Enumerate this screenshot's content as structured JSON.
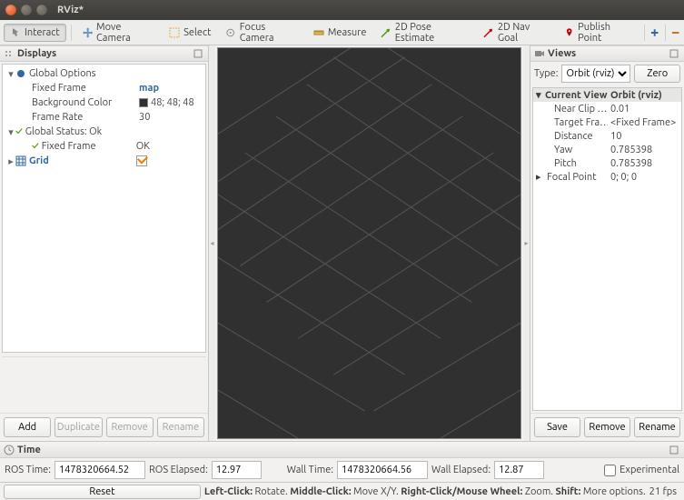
{
  "window": {
    "title": "RViz*"
  },
  "toolbar": [
    {
      "label": "Interact",
      "icon": "interact-icon",
      "active": true
    },
    {
      "label": "Move Camera",
      "icon": "move-camera-icon"
    },
    {
      "label": "Select",
      "icon": "select-icon"
    },
    {
      "label": "Focus Camera",
      "icon": "focus-camera-icon"
    },
    {
      "label": "Measure",
      "icon": "measure-icon"
    },
    {
      "label": "2D Pose Estimate",
      "icon": "pose-estimate-icon"
    },
    {
      "label": "2D Nav Goal",
      "icon": "nav-goal-icon"
    },
    {
      "label": "Publish Point",
      "icon": "publish-point-icon"
    }
  ],
  "displays": {
    "title": "Displays",
    "global_options": {
      "label": "Global Options",
      "fixed_frame": {
        "label": "Fixed Frame",
        "value": "map"
      },
      "background_color": {
        "label": "Background Color",
        "value": "48; 48; 48"
      },
      "frame_rate": {
        "label": "Frame Rate",
        "value": "30"
      }
    },
    "global_status": {
      "label": "Global Status: Ok",
      "fixed_frame": {
        "label": "Fixed Frame",
        "value": "OK"
      }
    },
    "grid": {
      "label": "Grid",
      "checked": true
    },
    "buttons": {
      "add": "Add",
      "duplicate": "Duplicate",
      "remove": "Remove",
      "rename": "Rename"
    }
  },
  "views": {
    "title": "Views",
    "type_label": "Type:",
    "type_value": "Orbit (rviz)",
    "zero": "Zero",
    "current_view": {
      "label": "Current View",
      "value": "Orbit (rviz)"
    },
    "props": [
      {
        "label": "Near Clip …",
        "value": "0.01"
      },
      {
        "label": "Target Fra…",
        "value": "<Fixed Frame>"
      },
      {
        "label": "Distance",
        "value": "10"
      },
      {
        "label": "Yaw",
        "value": "0.785398"
      },
      {
        "label": "Pitch",
        "value": "0.785398"
      },
      {
        "label": "Focal Point",
        "value": "0; 0; 0"
      }
    ],
    "buttons": {
      "save": "Save",
      "remove": "Remove",
      "rename": "Rename"
    }
  },
  "time": {
    "title": "Time",
    "ros_time_label": "ROS Time:",
    "ros_time": "1478320664.52",
    "ros_elapsed_label": "ROS Elapsed:",
    "ros_elapsed": "12.97",
    "wall_time_label": "Wall Time:",
    "wall_time": "1478320664.56",
    "wall_elapsed_label": "Wall Elapsed:",
    "wall_elapsed": "12.87",
    "experimental": "Experimental"
  },
  "status": {
    "reset": "Reset",
    "hint_parts": {
      "p1": "Left-Click:",
      "v1": " Rotate. ",
      "p2": "Middle-Click:",
      "v2": " Move X/Y. ",
      "p3": "Right-Click/Mouse Wheel:",
      "v3": " Zoom. ",
      "p4": "Shift:",
      "v4": " More options."
    },
    "fps": "21 fps"
  }
}
